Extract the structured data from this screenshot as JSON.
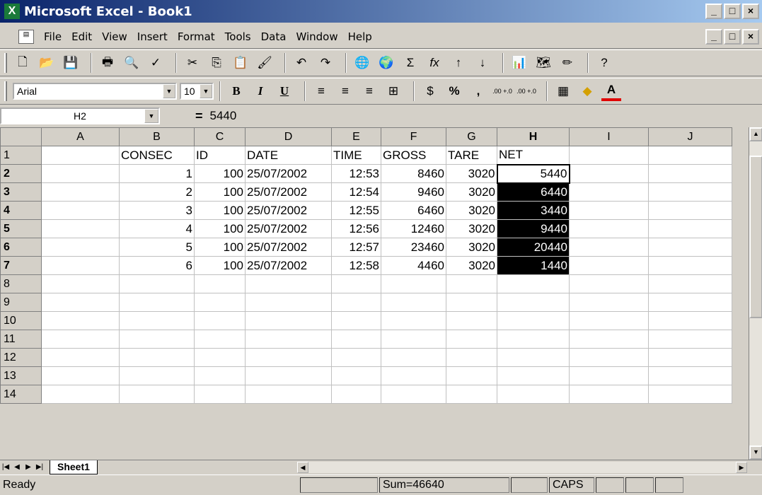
{
  "window": {
    "app_icon": "excel-icon",
    "title": "Microsoft Excel - Book1",
    "minimize": "_",
    "maximize": "□",
    "close": "×"
  },
  "menu": {
    "items": [
      "File",
      "Edit",
      "View",
      "Insert",
      "Format",
      "Tools",
      "Data",
      "Window",
      "Help"
    ]
  },
  "formatting": {
    "font_name": "Arial",
    "font_size": "10",
    "bold": "B",
    "italic": "I",
    "underline": "U",
    "percent": "%",
    "comma": ",",
    "increase_decimal": ".00 +.0",
    "decrease_decimal": ".00 +.0",
    "font_color_letter": "A"
  },
  "standard_toolbar": {
    "autosum": "Σ",
    "function": "fx"
  },
  "formula_bar": {
    "name_box": "H2",
    "equals": "=",
    "value": "5440"
  },
  "sheet": {
    "columns": [
      "A",
      "B",
      "C",
      "D",
      "E",
      "F",
      "G",
      "H",
      "I",
      "J"
    ],
    "selected_column": "H",
    "row_numbers": [
      "1",
      "2",
      "3",
      "4",
      "5",
      "6",
      "7",
      "8",
      "9",
      "10",
      "11",
      "12",
      "13",
      "14"
    ],
    "header_row": [
      "",
      "CONSEC",
      "ID",
      "DATE",
      "TIME",
      "GROSS",
      "TARE",
      "NET",
      "",
      ""
    ],
    "data_rows": [
      [
        "",
        "1",
        "100",
        "25/07/2002",
        "12:53",
        "8460",
        "3020",
        "5440",
        "",
        ""
      ],
      [
        "",
        "2",
        "100",
        "25/07/2002",
        "12:54",
        "9460",
        "3020",
        "6440",
        "",
        ""
      ],
      [
        "",
        "3",
        "100",
        "25/07/2002",
        "12:55",
        "6460",
        "3020",
        "3440",
        "",
        ""
      ],
      [
        "",
        "4",
        "100",
        "25/07/2002",
        "12:56",
        "12460",
        "3020",
        "9440",
        "",
        ""
      ],
      [
        "",
        "5",
        "100",
        "25/07/2002",
        "12:57",
        "23460",
        "3020",
        "20440",
        "",
        ""
      ],
      [
        "",
        "6",
        "100",
        "25/07/2002",
        "12:58",
        "4460",
        "3020",
        "1440",
        "",
        ""
      ]
    ]
  },
  "tabs": {
    "sheet_name": "Sheet1"
  },
  "status": {
    "ready": "Ready",
    "sum": "Sum=46640",
    "caps": "CAPS"
  }
}
